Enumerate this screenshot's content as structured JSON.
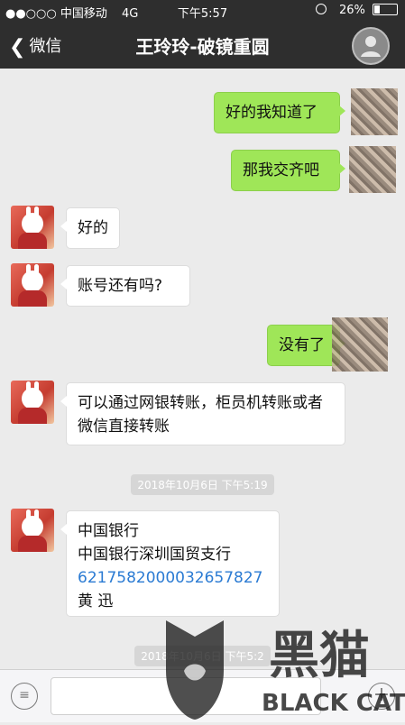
{
  "status_bar": {
    "signal": "●●○○○",
    "carrier": "中国移动",
    "network": "4G",
    "time": "下午5:57",
    "battery_text": "26%",
    "battery_level": 0.26
  },
  "nav": {
    "back_label": "微信",
    "title": "王玲玲-破镜重圆"
  },
  "messages": [
    {
      "side": "out",
      "text": "好的我知道了"
    },
    {
      "side": "out",
      "text": "那我交齐吧"
    },
    {
      "side": "in",
      "text": "好的"
    },
    {
      "side": "in",
      "text": "账号还有吗?"
    },
    {
      "side": "out",
      "text": "没有了"
    },
    {
      "side": "in",
      "text": "可以通过网银转账，柜员机转账或者微信直接转账"
    },
    {
      "side": "in",
      "lines": [
        "中国银行",
        "中国银行深圳国贸支行",
        "6217582000032657827",
        "黄 迅"
      ]
    }
  ],
  "timestamps": [
    "2018年10月6日 下午5:19",
    "2018年10月6日 下午5:2"
  ],
  "watermark": {
    "text_cn": "黑猫",
    "text_en": "BLACK CAT"
  },
  "colors": {
    "nav_bg": "#2e2e2e",
    "chat_bg": "#ebebeb",
    "bubble_out": "#9fe658",
    "bubble_in": "#ffffff",
    "link": "#2b7bd3"
  },
  "icons": [
    "back-chevron-icon",
    "profile-icon",
    "voice-icon",
    "plus-icon",
    "battery-icon",
    "alarm-icon"
  ]
}
